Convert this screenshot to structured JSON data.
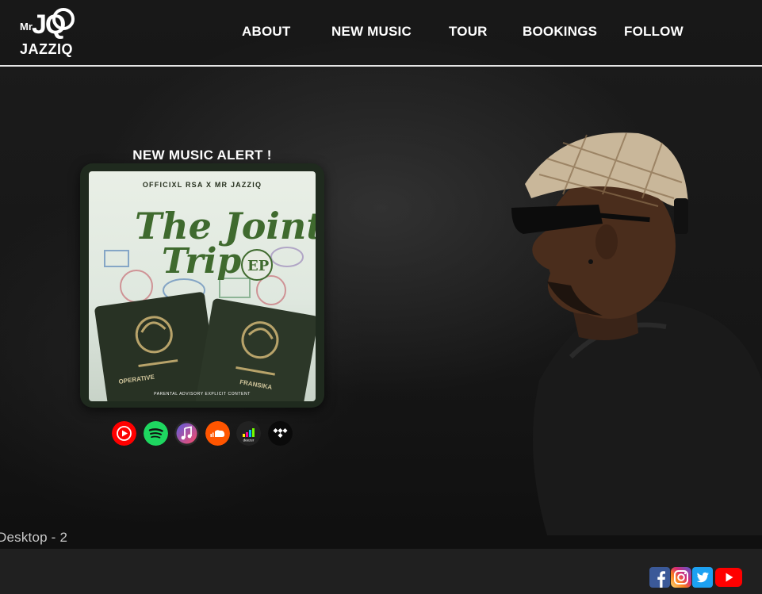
{
  "brand": {
    "logo_text_top": "Mr JQ",
    "logo_text_bottom": "JAZZIQ"
  },
  "nav": {
    "items": [
      {
        "label": "ABOUT"
      },
      {
        "label": "NEW MUSIC"
      },
      {
        "label": "TOUR"
      },
      {
        "label": "BOOKINGS"
      },
      {
        "label": "FOLLOW"
      }
    ]
  },
  "promo": {
    "heading": "NEW MUSIC ALERT !",
    "cover": {
      "credits": "OFFICIXL RSA   X   MR JAZZIQ",
      "title_line1": "The Joint",
      "title_line2": "Trip",
      "badge": "EP",
      "passport_left": "OPERATIVE",
      "passport_right": "FRANSIKA",
      "advisory": "PARENTAL ADVISORY EXPLICIT CONTENT"
    },
    "platforms": [
      {
        "name": "youtube-music",
        "icon": "youtube-music-icon",
        "color": "#ff0000"
      },
      {
        "name": "spotify",
        "icon": "spotify-icon",
        "color": "#1ed760"
      },
      {
        "name": "apple-music",
        "icon": "apple-music-icon",
        "color": "#fa4a66"
      },
      {
        "name": "soundcloud",
        "icon": "soundcloud-icon",
        "color": "#ff5500"
      },
      {
        "name": "deezer",
        "icon": "deezer-icon",
        "color": "#222222"
      },
      {
        "name": "tidal",
        "icon": "tidal-icon",
        "color": "#000000"
      }
    ]
  },
  "canvas": {
    "frame_label": "Desktop - 2"
  },
  "footer": {
    "social": [
      {
        "name": "facebook",
        "icon": "facebook-icon",
        "color": "#3b5998"
      },
      {
        "name": "instagram",
        "icon": "instagram-icon",
        "color": "#c13584"
      },
      {
        "name": "twitter",
        "icon": "twitter-icon",
        "color": "#1da1f2"
      },
      {
        "name": "youtube",
        "icon": "youtube-icon",
        "color": "#ff0000"
      }
    ]
  },
  "colors": {
    "background": "#141414",
    "divider": "#e6e6e6",
    "footer": "#202020"
  }
}
